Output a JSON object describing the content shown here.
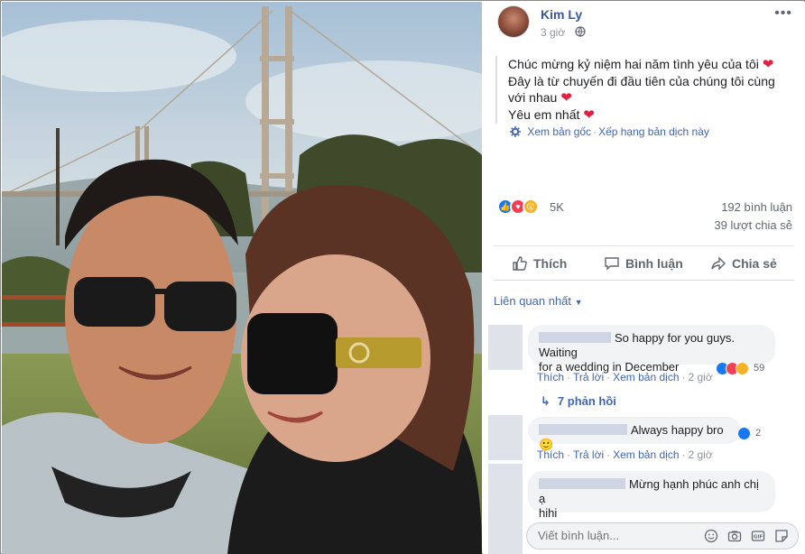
{
  "post": {
    "author": "Kim Ly",
    "time": "3 giờ",
    "caption_line1": "Chúc mừng kỷ niệm hai năm tình yêu của tôi",
    "caption_line2a": "Đây là từ chuyến đi đầu tiên của chúng tôi cùng",
    "caption_line2b": "với nhau",
    "caption_line3": "Yêu em nhất",
    "heart": "❤",
    "see_original": "Xem bản gốc",
    "rate_translation": "Xếp hạng bản dịch này",
    "reaction_count": "5K",
    "comments_count": "192 bình luận",
    "shares_count": "39 lượt chia sẻ"
  },
  "actions": {
    "like": "Thích",
    "comment": "Bình luận",
    "share": "Chia sẻ"
  },
  "sort_label": "Liên quan nhất",
  "comments": [
    {
      "text_line1": "So happy for you guys. Waiting",
      "text_line2": "for a wedding in December",
      "like": "Thích",
      "reply": "Trả lời",
      "translate": "Xem bản dịch",
      "time": "2 giờ",
      "reactions": "59"
    },
    {
      "text": "Always happy bro",
      "emoji": "🙂",
      "like": "Thích",
      "reply": "Trả lời",
      "translate": "Xem bản dịch",
      "time": "2 giờ",
      "reactions": "2"
    },
    {
      "text_line1": "Mừng hạnh phúc anh chị ạ",
      "text_line2": "hihi"
    }
  ],
  "replies_label": "7 phản hồi",
  "composer": {
    "placeholder": "Viết bình luận..."
  },
  "colors": {
    "link": "#385898",
    "accent": "#4267b2",
    "heart": "#e41e3f",
    "like": "#1877f2",
    "love": "#f33e58",
    "wow": "#f7b125"
  }
}
